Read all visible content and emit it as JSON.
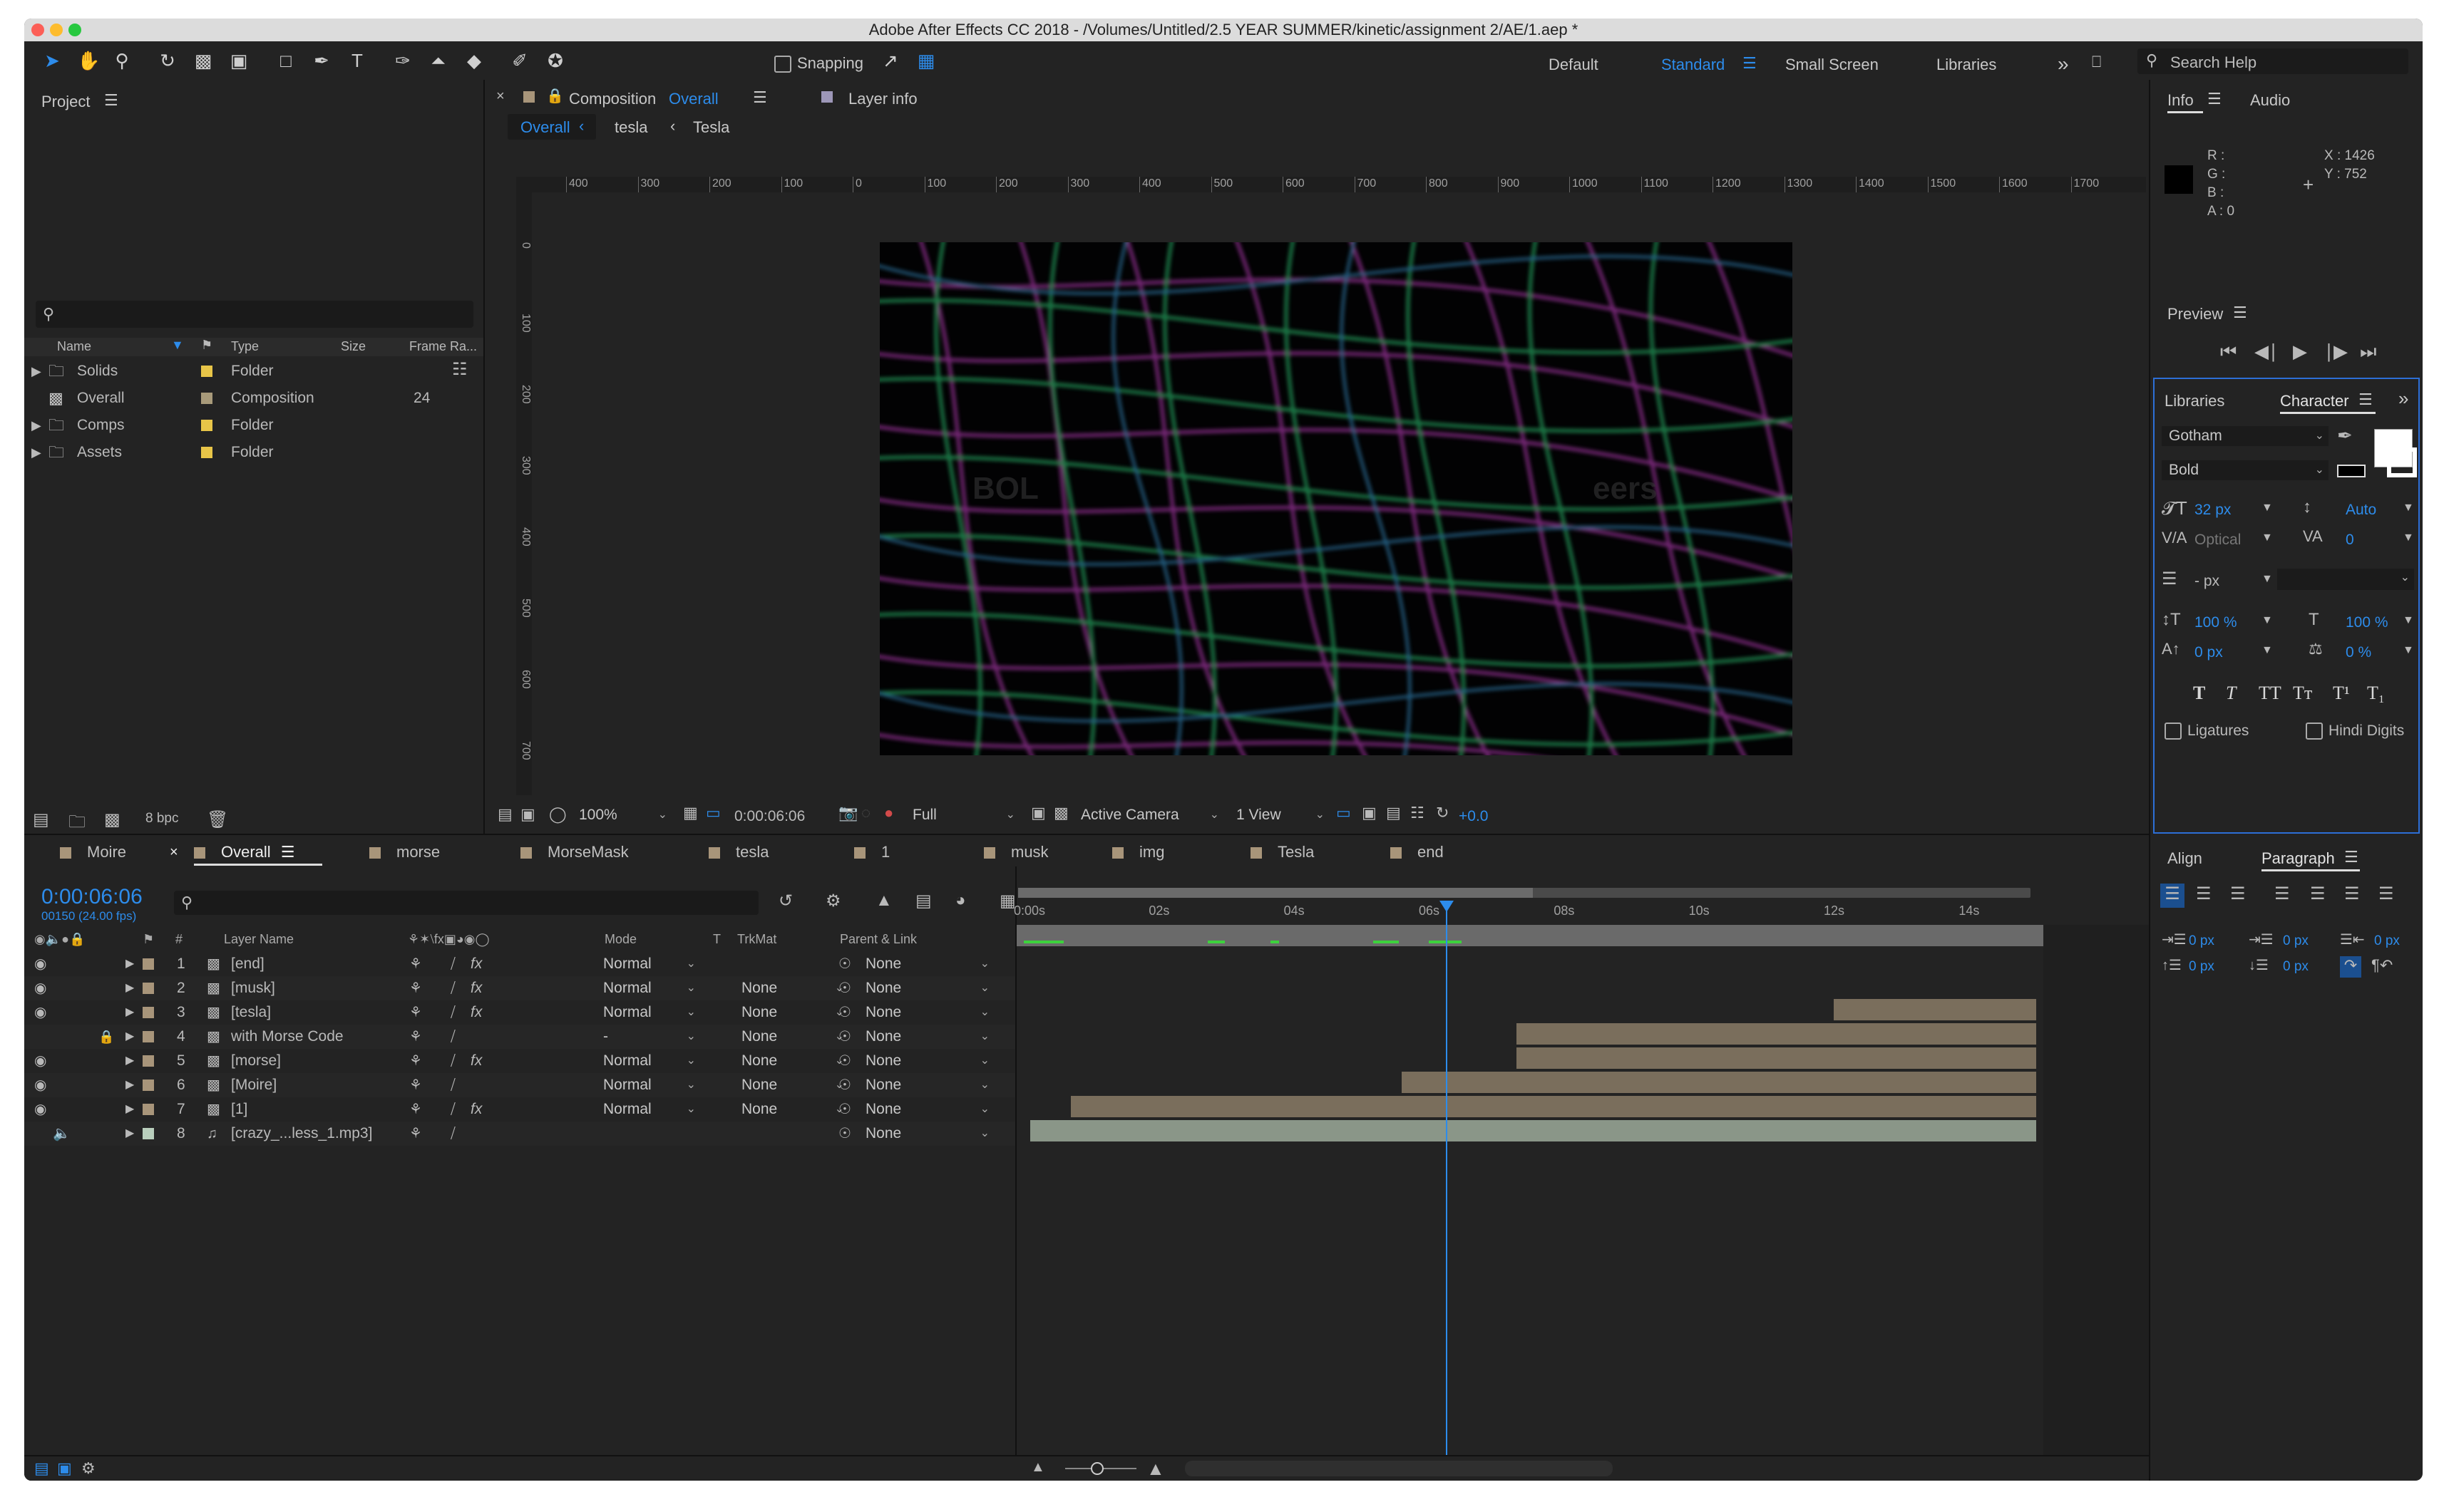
{
  "window": {
    "title": "Adobe After Effects CC 2018 - /Volumes/Untitled/2.5 YEAR SUMMER/kinetic/assignment 2/AE/1.aep *"
  },
  "toolbar": {
    "snapping_label": "Snapping",
    "workspaces": [
      "Default",
      "Standard",
      "Small Screen",
      "Libraries"
    ],
    "active_workspace": "Standard",
    "search_placeholder": "Search Help"
  },
  "project": {
    "panel_title": "Project",
    "columns": {
      "name": "Name",
      "type": "Type",
      "size": "Size",
      "frame_rate": "Frame Ra..."
    },
    "items": [
      {
        "name": "Solids",
        "type": "Folder",
        "frame_rate": ""
      },
      {
        "name": "Overall",
        "type": "Composition",
        "frame_rate": "24"
      },
      {
        "name": "Comps",
        "type": "Folder",
        "frame_rate": ""
      },
      {
        "name": "Assets",
        "type": "Folder",
        "frame_rate": ""
      }
    ],
    "bpc": "8 bpc"
  },
  "composition": {
    "tab_prefix": "Composition",
    "tab_name": "Overall",
    "layer_info_tab": "Layer info",
    "breadcrumbs": [
      "Overall",
      "tesla",
      "Tesla"
    ],
    "ruler_ticks": [
      "400",
      "300",
      "200",
      "100",
      "0",
      "100",
      "200",
      "300",
      "400",
      "500",
      "600",
      "700",
      "800",
      "900",
      "1000",
      "1100",
      "1200",
      "1300",
      "1400",
      "1500",
      "1600",
      "1700"
    ],
    "vruler_ticks": [
      "0",
      "100",
      "200",
      "300",
      "400",
      "500",
      "600",
      "700"
    ],
    "overlay_left": "BOL",
    "overlay_right": "eers",
    "zoom": "100%",
    "timecode": "0:00:06:06",
    "resolution": "Full",
    "camera": "Active Camera",
    "views": "1 View",
    "exposure": "+0.0"
  },
  "info": {
    "tabs": [
      "Info",
      "Audio"
    ],
    "r_label": "R :",
    "g_label": "G :",
    "b_label": "B :",
    "a_label": "A :  0",
    "x_label": "X : 1426",
    "y_label": "Y : 752"
  },
  "preview": {
    "title": "Preview"
  },
  "character": {
    "tabs": [
      "Libraries",
      "Character"
    ],
    "font": "Gotham",
    "style": "Bold",
    "size": "32 px",
    "leading": "Auto",
    "kerning": "Optical",
    "tracking": "0",
    "stroke": "- px",
    "vscale": "100 %",
    "hscale": "100 %",
    "baseline": "0 px",
    "tsume": "0 %",
    "ligatures_label": "Ligatures",
    "hindi_label": "Hindi Digits",
    "style_buttons": [
      "T",
      "T",
      "TT",
      "Tт",
      "T¹",
      "T₁"
    ]
  },
  "paragraph": {
    "tabs": [
      "Align",
      "Paragraph"
    ],
    "indent_left": "0 px",
    "indent_first": "0 px",
    "indent_right": "0 px",
    "space_before": "0 px",
    "space_after": "0 px",
    "extra": "0 px"
  },
  "timeline": {
    "tabs": [
      "Moire",
      "Overall",
      "morse",
      "MorseMask",
      "tesla",
      "1",
      "musk",
      "img",
      "Tesla",
      "end"
    ],
    "active_tab": "Overall",
    "timecode": "0:00:06:06",
    "frames": "00150 (24.00 fps)",
    "columns": {
      "num": "#",
      "layer_name": "Layer Name",
      "mode": "Mode",
      "t": "T",
      "trkmat": "TrkMat",
      "parent": "Parent & Link"
    },
    "time_labels": [
      "0:00s",
      "02s",
      "04s",
      "06s",
      "08s",
      "10s",
      "12s",
      "14s"
    ],
    "playhead_seconds": 6.25,
    "duration_seconds": 15,
    "layers": [
      {
        "num": "1",
        "name": "[end]",
        "mode": "Normal",
        "trkmat": "",
        "parent": "None",
        "start": 0,
        "end": 0,
        "color": "#b8a27a"
      },
      {
        "num": "2",
        "name": "[musk]",
        "mode": "Normal",
        "trkmat": "None",
        "parent": "None",
        "start": 0,
        "end": 0,
        "color": "#b8a27a"
      },
      {
        "num": "3",
        "name": "[tesla]",
        "mode": "Normal",
        "trkmat": "None",
        "parent": "None",
        "start": 12.0,
        "end": 15,
        "color": "#7a6e5c"
      },
      {
        "num": "4",
        "name": "with Morse Code",
        "mode": "-",
        "trkmat": "None",
        "parent": "None",
        "start": 7.3,
        "end": 15,
        "color": "#7a6e5c"
      },
      {
        "num": "5",
        "name": "[morse]",
        "mode": "Normal",
        "trkmat": "None",
        "parent": "None",
        "start": 7.3,
        "end": 15,
        "color": "#7a6e5c"
      },
      {
        "num": "6",
        "name": "[Moire]",
        "mode": "Normal",
        "trkmat": "None",
        "parent": "None",
        "start": 5.6,
        "end": 15,
        "color": "#7a6e5c"
      },
      {
        "num": "7",
        "name": "[1]",
        "mode": "Normal",
        "trkmat": "None",
        "parent": "None",
        "start": 0.7,
        "end": 15,
        "color": "#7a6e5c"
      },
      {
        "num": "8",
        "name": "[crazy_...less_1.mp3]",
        "mode": "",
        "trkmat": "",
        "parent": "None",
        "start": 0.1,
        "end": 15,
        "color": "#8a9688"
      }
    ]
  }
}
